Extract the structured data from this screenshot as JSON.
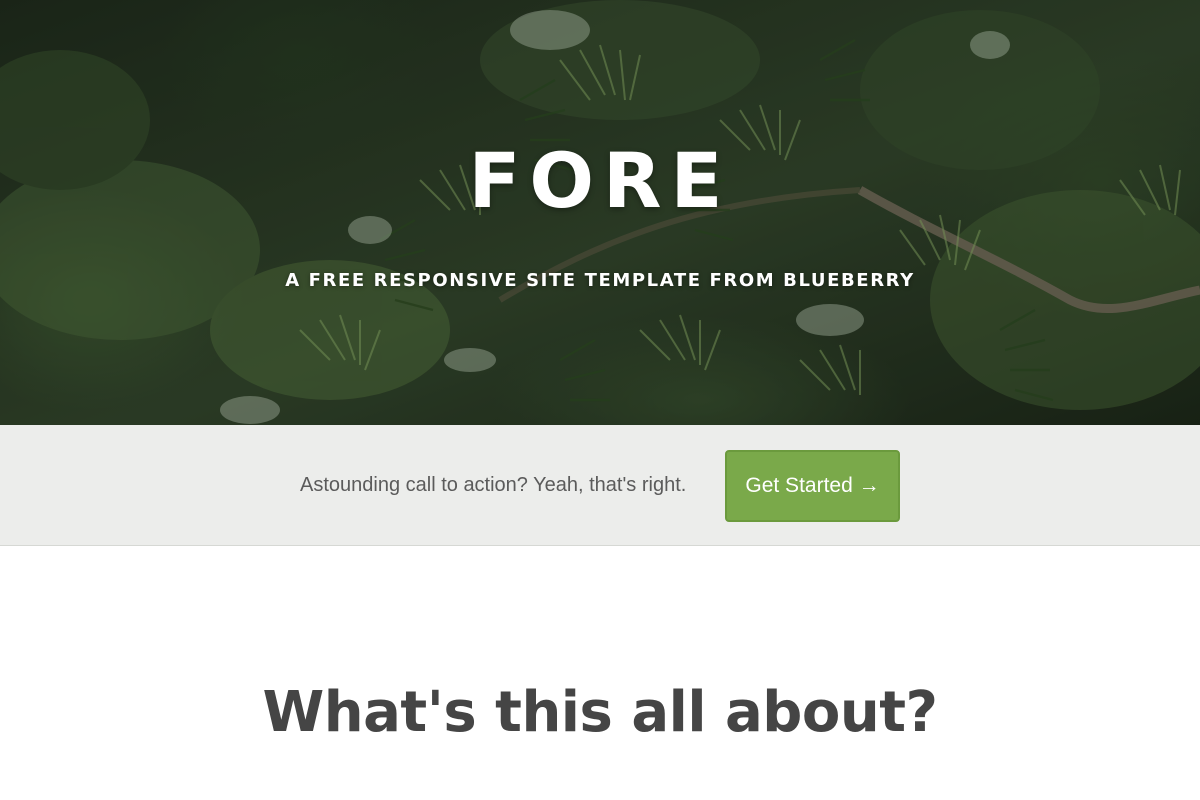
{
  "hero": {
    "title": "FORE",
    "subtitle": "A FREE RESPONSIVE SITE TEMPLATE FROM BLUEBERRY",
    "background_image": "pine-branch-photo"
  },
  "cta": {
    "message": "Astounding call to action? Yeah, that's right.",
    "button_label": "Get Started →",
    "button_color": "#7aa94a"
  },
  "about": {
    "heading": "What's this all about?"
  },
  "colors": {
    "cta_bar_background": "#ecedeb",
    "heading_text": "#454545",
    "body_text": "#5b5b5b"
  }
}
